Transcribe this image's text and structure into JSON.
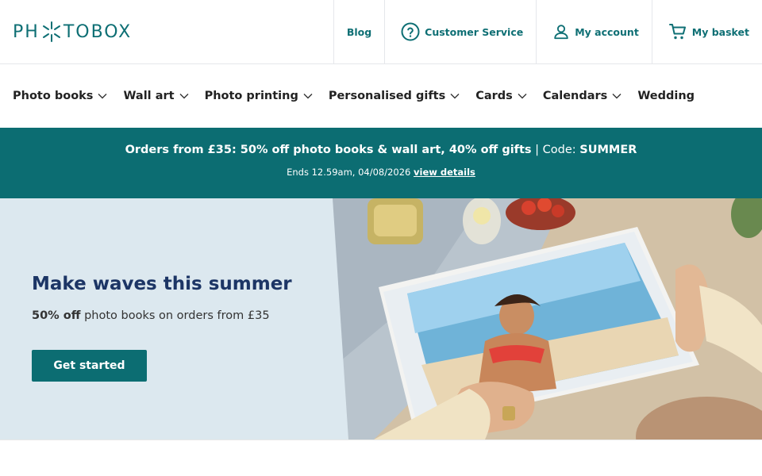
{
  "brand": {
    "logo_text_left": "PH",
    "logo_text_right": "TOBOX",
    "color": "#0e6f74"
  },
  "top_links": [
    {
      "label": "Blog",
      "icon": "none"
    },
    {
      "label": "Customer Service",
      "icon": "help-circle-icon"
    },
    {
      "label": "My account",
      "icon": "user-icon"
    },
    {
      "label": "My basket",
      "icon": "cart-icon"
    }
  ],
  "nav": [
    {
      "label": "Photo books",
      "dropdown": true
    },
    {
      "label": "Wall art",
      "dropdown": true
    },
    {
      "label": "Photo printing",
      "dropdown": true
    },
    {
      "label": "Personalised gifts",
      "dropdown": true
    },
    {
      "label": "Cards",
      "dropdown": true
    },
    {
      "label": "Calendars",
      "dropdown": true
    },
    {
      "label": "Wedding",
      "dropdown": false
    }
  ],
  "promo": {
    "headline": "Orders from £35: 50% off photo books & wall art, 40% off gifts",
    "separator": " | Code: ",
    "code": "SUMMER",
    "ends": "Ends 12.59am, 04/08/2026 ",
    "details_link": "view details",
    "background": "#0c6d72"
  },
  "hero": {
    "title": "Make waves this summer",
    "sub_bold": "50% off",
    "sub_rest": " photo books on orders from £35",
    "button": "Get started",
    "background": "#dce8ef"
  }
}
